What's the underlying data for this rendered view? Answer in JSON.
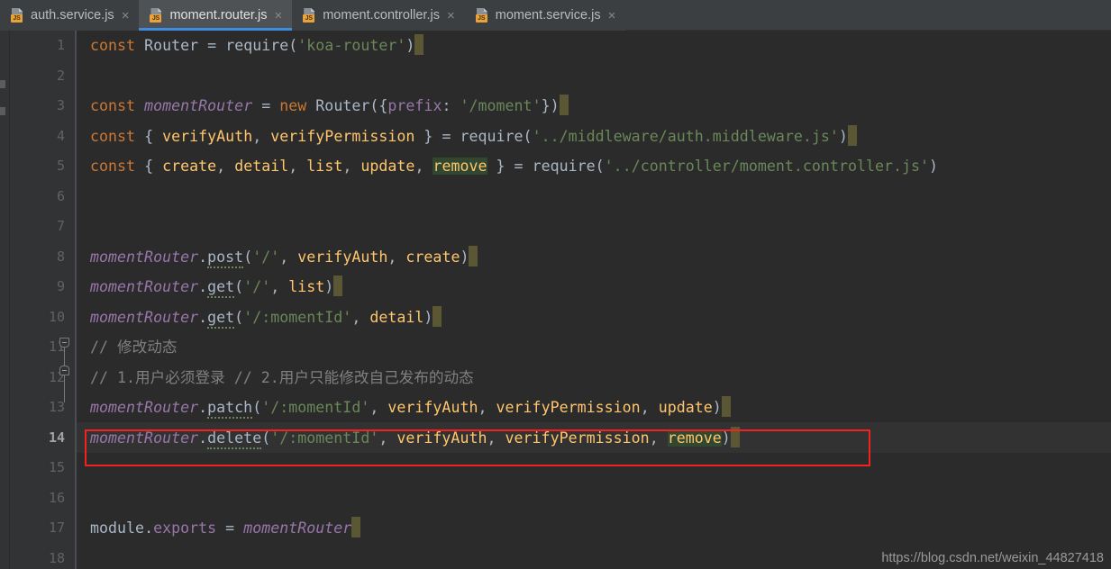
{
  "window": {
    "app": "IntelliJ IDEA / WebStorm code editor",
    "background": "#2b2b2b"
  },
  "colors": {
    "editor_bg": "#2b2b2b",
    "gutter_bg": "#313335",
    "tabbar_bg": "#3c3f41",
    "active_tab_bg": "#4e5254",
    "active_tab_underline": "#3c8ce0",
    "keyword": "#cc7832",
    "string": "#6a8759",
    "identifier": "#a9b7c6",
    "parameter": "#ffc66d",
    "field": "#9876aa",
    "comment": "#808080",
    "annotation_box": "#f42121",
    "search_highlight": "#32472f",
    "eol_marker": "#5b5634"
  },
  "tabs": [
    {
      "label": "auth.service.js",
      "icon": "js-file-icon",
      "close": "×",
      "active": false
    },
    {
      "label": "moment.router.js",
      "icon": "js-file-icon",
      "close": "×",
      "active": true
    },
    {
      "label": "moment.controller.js",
      "icon": "js-file-icon",
      "close": "×",
      "active": false
    },
    {
      "label": "moment.service.js",
      "icon": "js-file-icon",
      "close": "×",
      "active": false
    }
  ],
  "editor": {
    "current_line": 14,
    "line_numbers": [
      "1",
      "2",
      "3",
      "4",
      "5",
      "6",
      "7",
      "8",
      "9",
      "10",
      "11",
      "12",
      "13",
      "14",
      "15",
      "16",
      "17",
      "18"
    ],
    "lines": {
      "1": "const Router = require('koa-router')",
      "2": "",
      "3": "const momentRouter = new Router({prefix: '/moment'})",
      "4": "const { verifyAuth, verifyPermission } = require('../middleware/auth.middleware.js')",
      "5": "const { create, detail, list, update, remove } = require('../controller/moment.controller.js')",
      "6": "",
      "7": "",
      "8": "momentRouter.post('/', verifyAuth, create)",
      "9": "momentRouter.get('/', list)",
      "10": "momentRouter.get('/:momentId', detail)",
      "11": "// 修改动态",
      "12": "// 1.用户必须登录 // 2.用户只能修改自己发布的动态",
      "13": "momentRouter.patch('/:momentId', verifyAuth, verifyPermission, update)",
      "14": "momentRouter.delete('/:momentId', verifyAuth, verifyPermission, remove)",
      "15": "",
      "16": "",
      "17": "module.exports = momentRouter",
      "18": ""
    },
    "tokens": {
      "const": "const",
      "new": "new",
      "Router": "Router",
      "require": "require",
      "koa_router_str": "'koa-router'",
      "momentRouter": "momentRouter",
      "prefix_key": "prefix",
      "moment_str": "'/moment'",
      "verifyAuth": "verifyAuth",
      "verifyPermission": "verifyPermission",
      "auth_mw_str": "'../middleware/auth.middleware.js'",
      "create": "create",
      "detail": "detail",
      "list": "list",
      "update": "update",
      "remove": "remove",
      "controller_str": "'../controller/moment.controller.js'",
      "post": "post",
      "get": "get",
      "patch": "patch",
      "delete": "delete",
      "root_str": "'/'",
      "momentId_str": "'/:momentId'",
      "module": "module",
      "exports": "exports",
      "comment_11": "// 修改动态",
      "comment_12": "// 1.用户必须登录 // 2.用户只能修改自己发布的动态"
    }
  },
  "annotation": {
    "type": "red-rectangle-highlight",
    "target_line": 14
  },
  "watermark": {
    "text": "https://blog.csdn.net/weixin_44827418"
  }
}
